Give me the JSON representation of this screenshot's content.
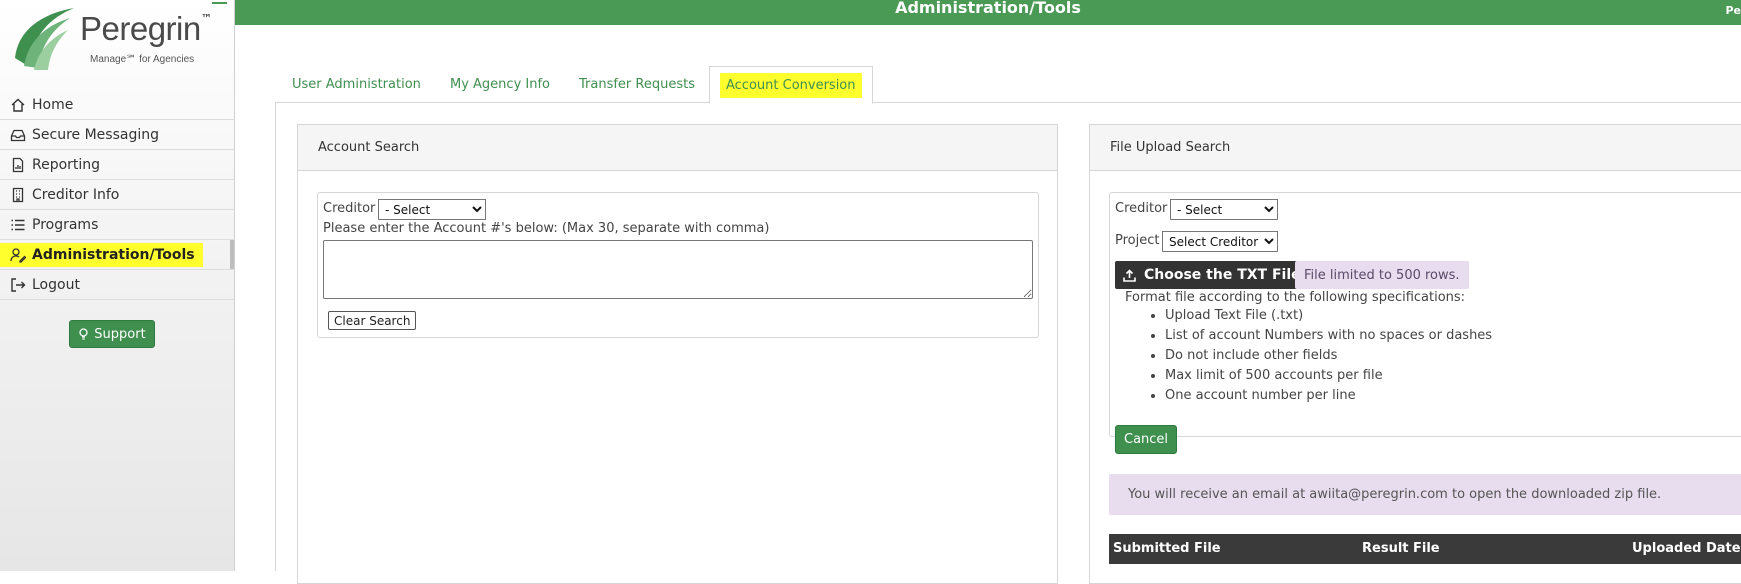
{
  "app": {
    "brand_name": "Peregrin",
    "brand_tm": "™",
    "brand_subtitle": "Manage℠ for Agencies"
  },
  "header": {
    "title": "Administration/Tools",
    "corner_text": "Pe"
  },
  "sidebar": {
    "items": [
      {
        "label": "Home",
        "icon": "home-icon"
      },
      {
        "label": "Secure Messaging",
        "icon": "inbox-icon"
      },
      {
        "label": "Reporting",
        "icon": "report-icon"
      },
      {
        "label": "Creditor Info",
        "icon": "building-icon"
      },
      {
        "label": "Programs",
        "icon": "list-icon"
      },
      {
        "label": "Administration/Tools",
        "icon": "user-edit-icon",
        "active": true
      },
      {
        "label": "Logout",
        "icon": "logout-icon"
      }
    ],
    "support_label": "Support"
  },
  "tabs": [
    {
      "label": "User Administration"
    },
    {
      "label": "My Agency Info"
    },
    {
      "label": "Transfer Requests"
    },
    {
      "label": "Account Conversion",
      "active": true
    }
  ],
  "account_search": {
    "title": "Account Search",
    "creditor_label": "Creditor",
    "creditor_value": "- Select",
    "instructions": "Please enter the Account #'s below: (Max 30, separate with comma)",
    "textarea_value": "",
    "clear_label": "Clear Search"
  },
  "file_upload": {
    "title": "File Upload Search",
    "creditor_label": "Creditor",
    "creditor_value": "- Select",
    "project_label": "Project",
    "project_value": "Select Creditor",
    "choose_label": "Choose the TXT File",
    "limit_note": "File limited to 500 rows.",
    "format_intro": "Format file according to the following specifications:",
    "specs": [
      "Upload Text File (.txt)",
      "List of account Numbers with no spaces or dashes",
      "Do not include other fields",
      "Max limit of 500 accounts per file",
      "One account number per line"
    ],
    "cancel_label": "Cancel",
    "email_note": "You will receive an email at awiita@peregrin.com to open the downloaded zip file.",
    "table_headers": {
      "submitted": "Submitted File",
      "result": "Result File",
      "uploaded": "Uploaded Date"
    }
  },
  "colors": {
    "brand_green": "#4a9a56",
    "highlight_yellow": "#ffff2e",
    "note_lavender": "#e8dcef",
    "dark_button": "#333333"
  }
}
